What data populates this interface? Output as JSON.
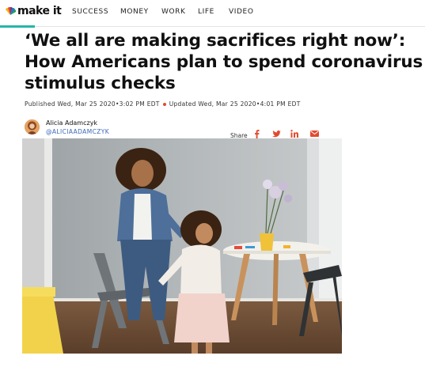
{
  "nav": {
    "logo_text": "make it",
    "links": [
      {
        "label": "SUCCESS"
      },
      {
        "label": "MONEY"
      },
      {
        "label": "WORK"
      },
      {
        "label": "LIFE"
      },
      {
        "label": "VIDEO"
      }
    ]
  },
  "article": {
    "headline_lines": [
      "‘We all are making sacrifices right now’:",
      "How Americans plan to spend coronavirus",
      "stimulus checks"
    ],
    "published": "Published Wed, Mar 25 2020•3:02 PM EDT",
    "updated": "Updated Wed, Mar 25 2020•4:01 PM EDT",
    "author": {
      "name": "Alicia Adamczyk",
      "handle": "@ALICIAADAMCZYK"
    },
    "share": {
      "label": "Share",
      "icons": [
        "facebook-icon",
        "twitter-icon",
        "linkedin-icon",
        "email-icon"
      ]
    }
  },
  "colors": {
    "accent": "#26b5a6",
    "share_red": "#e24a2e",
    "handle_blue": "#3a68b8"
  }
}
